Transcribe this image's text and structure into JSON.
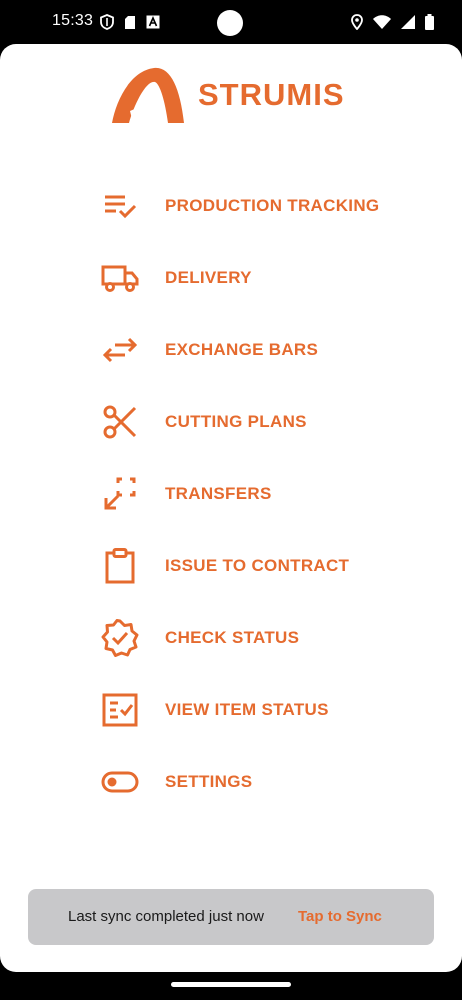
{
  "status_bar": {
    "time": "15:33",
    "left_icons": [
      "shield-icon",
      "sd-card-icon",
      "font-a-icon"
    ],
    "right_icons": [
      "location-icon",
      "wifi-icon",
      "signal-icon",
      "battery-icon"
    ]
  },
  "app": {
    "brand": "STRUMIS",
    "accent_color": "#E56B2F"
  },
  "menu": {
    "items": [
      {
        "label": "PRODUCTION TRACKING",
        "icon": "checklist-icon"
      },
      {
        "label": "DELIVERY",
        "icon": "truck-icon"
      },
      {
        "label": "EXCHANGE BARS",
        "icon": "swap-arrows-icon"
      },
      {
        "label": "CUTTING PLANS",
        "icon": "scissors-icon"
      },
      {
        "label": "TRANSFERS",
        "icon": "transfer-icon"
      },
      {
        "label": "ISSUE TO CONTRACT",
        "icon": "clipboard-icon"
      },
      {
        "label": "CHECK STATUS",
        "icon": "verified-badge-icon"
      },
      {
        "label": "VIEW ITEM STATUS",
        "icon": "list-check-icon"
      },
      {
        "label": "SETTINGS",
        "icon": "toggle-icon"
      }
    ]
  },
  "sync": {
    "message": "Last sync completed just now",
    "action": "Tap to Sync"
  }
}
